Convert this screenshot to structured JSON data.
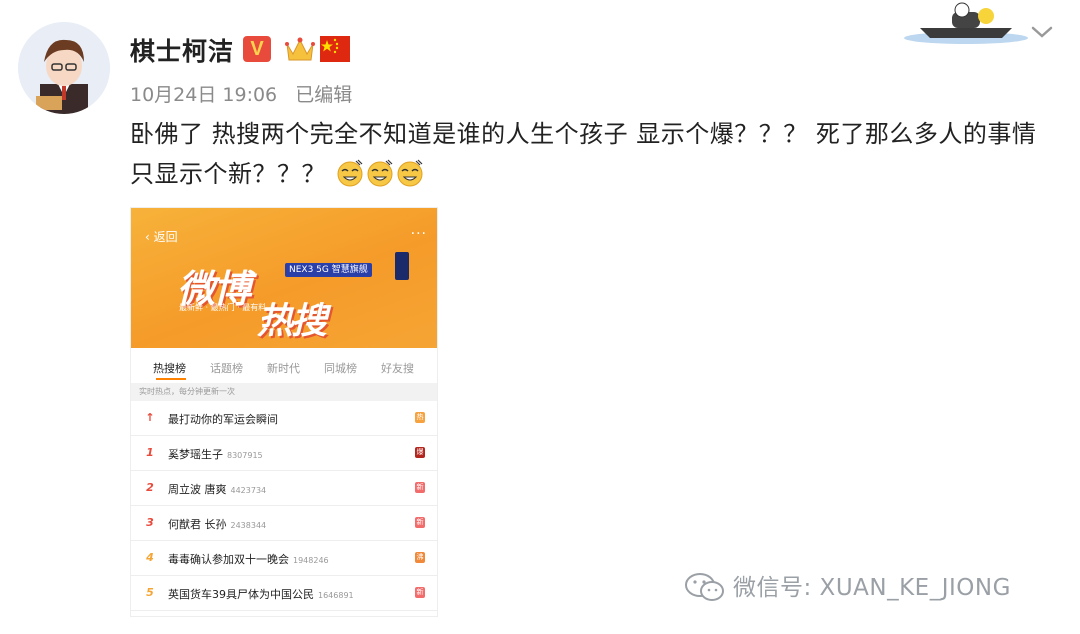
{
  "post": {
    "username": "棋士柯洁",
    "verified_badge": "V",
    "date": "10月24日 19:06",
    "edited_label": "已编辑",
    "text": "卧佛了 热搜两个完全不知道是谁的人生个孩子 显示个爆？？？ 死了那么多人的事情只显示个新？？？",
    "emoji": "sweat-smile-emoji",
    "emoji_count": 3
  },
  "colors": {
    "accent_orange": "#ff8200",
    "banner_orange": "#f5a534",
    "badge_red": "#e84b3c"
  },
  "embedded": {
    "back_label": "返回",
    "more_label": "···",
    "banner_title": "微博",
    "banner_hot": "热搜",
    "banner_slogan": "最新鲜 · 最热门 · 最有料",
    "nex_label": "NEX3 5G 智慧旗舰",
    "tabs": [
      {
        "label": "热搜榜"
      },
      {
        "label": "话题榜"
      },
      {
        "label": "新时代"
      },
      {
        "label": "同城榜"
      },
      {
        "label": "好友搜"
      }
    ],
    "subhead": "实时热点，每分钟更新一次",
    "rows": [
      {
        "rank": "↑",
        "title": "最打动你的军运会瞬间",
        "count": "",
        "tag": "热",
        "tag_color": "#f6a23e",
        "rank_color": "#e84b3c"
      },
      {
        "rank": "1",
        "title": "奚梦瑶生子",
        "count": "8307915",
        "tag": "爆",
        "tag_color": "#b3261e",
        "rank_color": "#e84b3c"
      },
      {
        "rank": "2",
        "title": "周立波 唐爽",
        "count": "4423734",
        "tag": "新",
        "tag_color": "#f36c6c",
        "rank_color": "#e84b3c"
      },
      {
        "rank": "3",
        "title": "何猷君 长孙",
        "count": "2438344",
        "tag": "新",
        "tag_color": "#f36c6c",
        "rank_color": "#e84b3c"
      },
      {
        "rank": "4",
        "title": "毒毒确认参加双十一晚会",
        "count": "1948246",
        "tag": "沸",
        "tag_color": "#f08a3a",
        "rank_color": "#f5a534"
      },
      {
        "rank": "5",
        "title": "英国货车39具尸体为中国公民",
        "count": "1646891",
        "tag": "新",
        "tag_color": "#f36c6c",
        "rank_color": "#f5a534"
      }
    ]
  },
  "watermark": "微信号: XUAN_KE_JIONG"
}
